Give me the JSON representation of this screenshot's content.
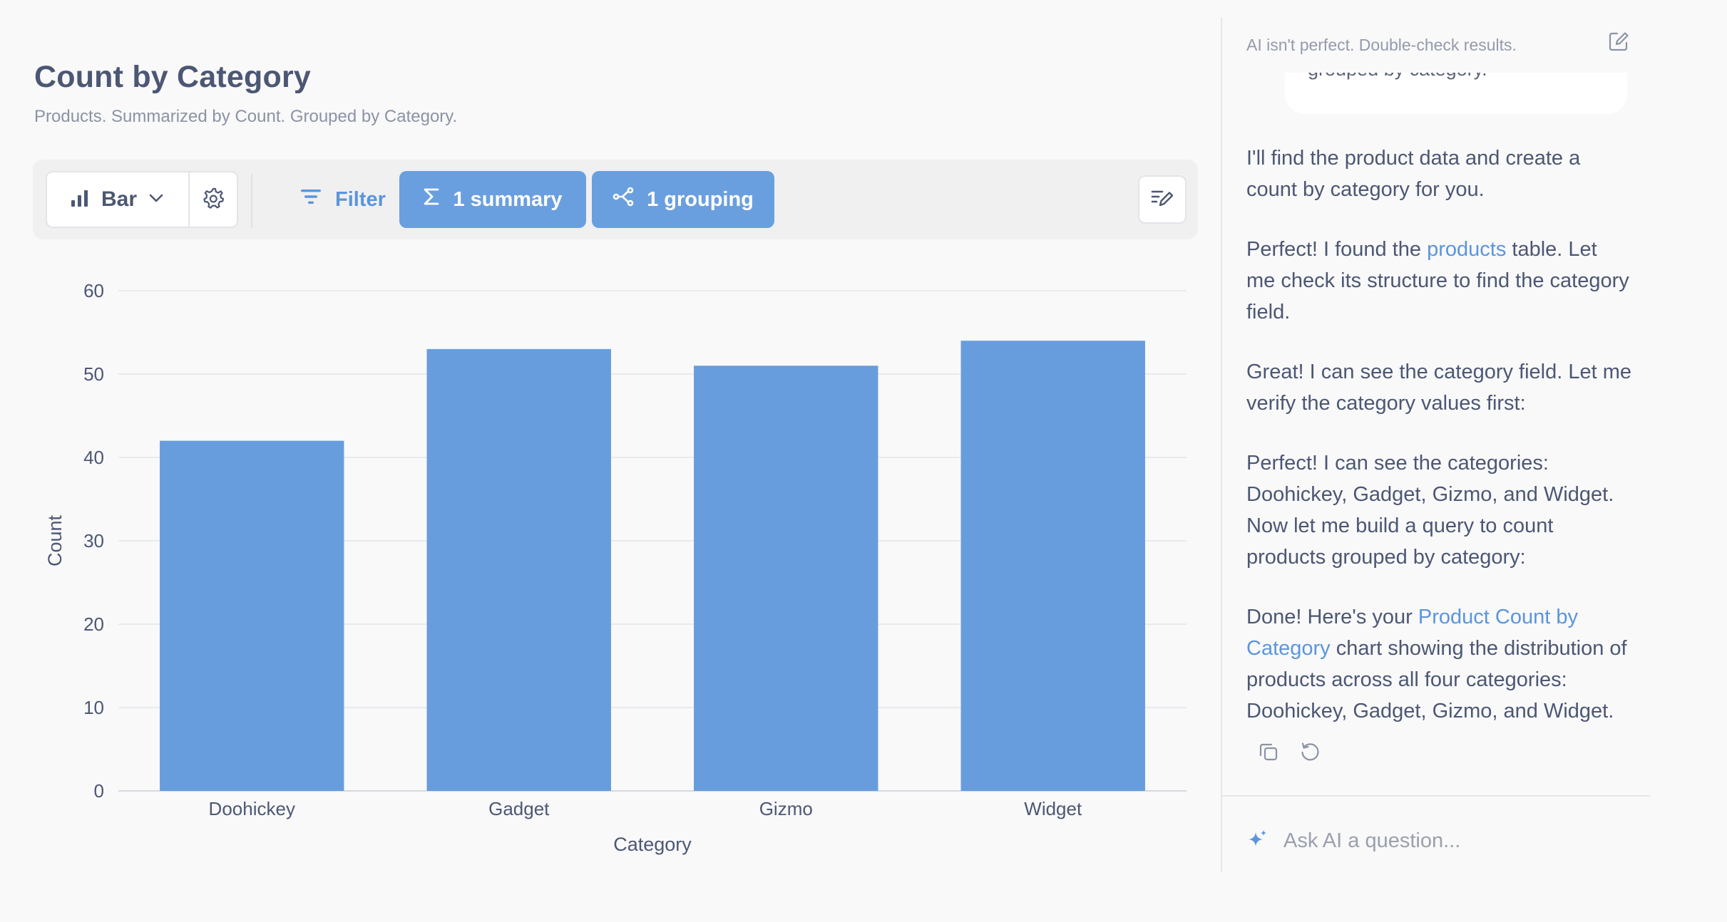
{
  "header": {
    "title": "Count by Category",
    "subtitle": "Products. Summarized by Count. Grouped by Category."
  },
  "toolbar": {
    "viz_label": "Bar",
    "filter_label": "Filter",
    "summary_label": "1 summary",
    "grouping_label": "1 grouping"
  },
  "colors": {
    "accent": "#6a9fdf",
    "bar": "#679ddd",
    "link": "#5b95dc",
    "text": "#4c5773"
  },
  "chart_data": {
    "type": "bar",
    "categories": [
      "Doohickey",
      "Gadget",
      "Gizmo",
      "Widget"
    ],
    "series": [
      {
        "values": [
          42,
          53,
          51,
          54
        ]
      }
    ],
    "xlabel": "Category",
    "ylabel": "Count",
    "ylim": [
      0,
      60
    ],
    "yticks": [
      0,
      10,
      20,
      30,
      40,
      50,
      60
    ],
    "grid": true
  },
  "sidebar": {
    "disclaimer": "AI isn't perfect. Double-check results.",
    "user_message": "grouped by category.",
    "messages": [
      {
        "parts": [
          {
            "text": "I'll find the product data and create a count by category for you."
          }
        ]
      },
      {
        "parts": [
          {
            "text": "Perfect! I found the "
          },
          {
            "text": "products",
            "link": true
          },
          {
            "text": " table. Let me check its structure to find the category field."
          }
        ]
      },
      {
        "parts": [
          {
            "text": "Great! I can see the category field. Let me verify the category values first:"
          }
        ]
      },
      {
        "parts": [
          {
            "text": "Perfect! I can see the categories: Doohickey, Gadget, Gizmo, and Widget. Now let me build a query to count products grouped by category:"
          }
        ]
      },
      {
        "parts": [
          {
            "text": "Done! Here's your "
          },
          {
            "text": "Product Count by Category",
            "link": true
          },
          {
            "text": " chart showing the distribution of products across all four categories: Doohickey, Gadget, Gizmo, and Widget."
          }
        ]
      }
    ],
    "input_placeholder": "Ask AI a question..."
  }
}
